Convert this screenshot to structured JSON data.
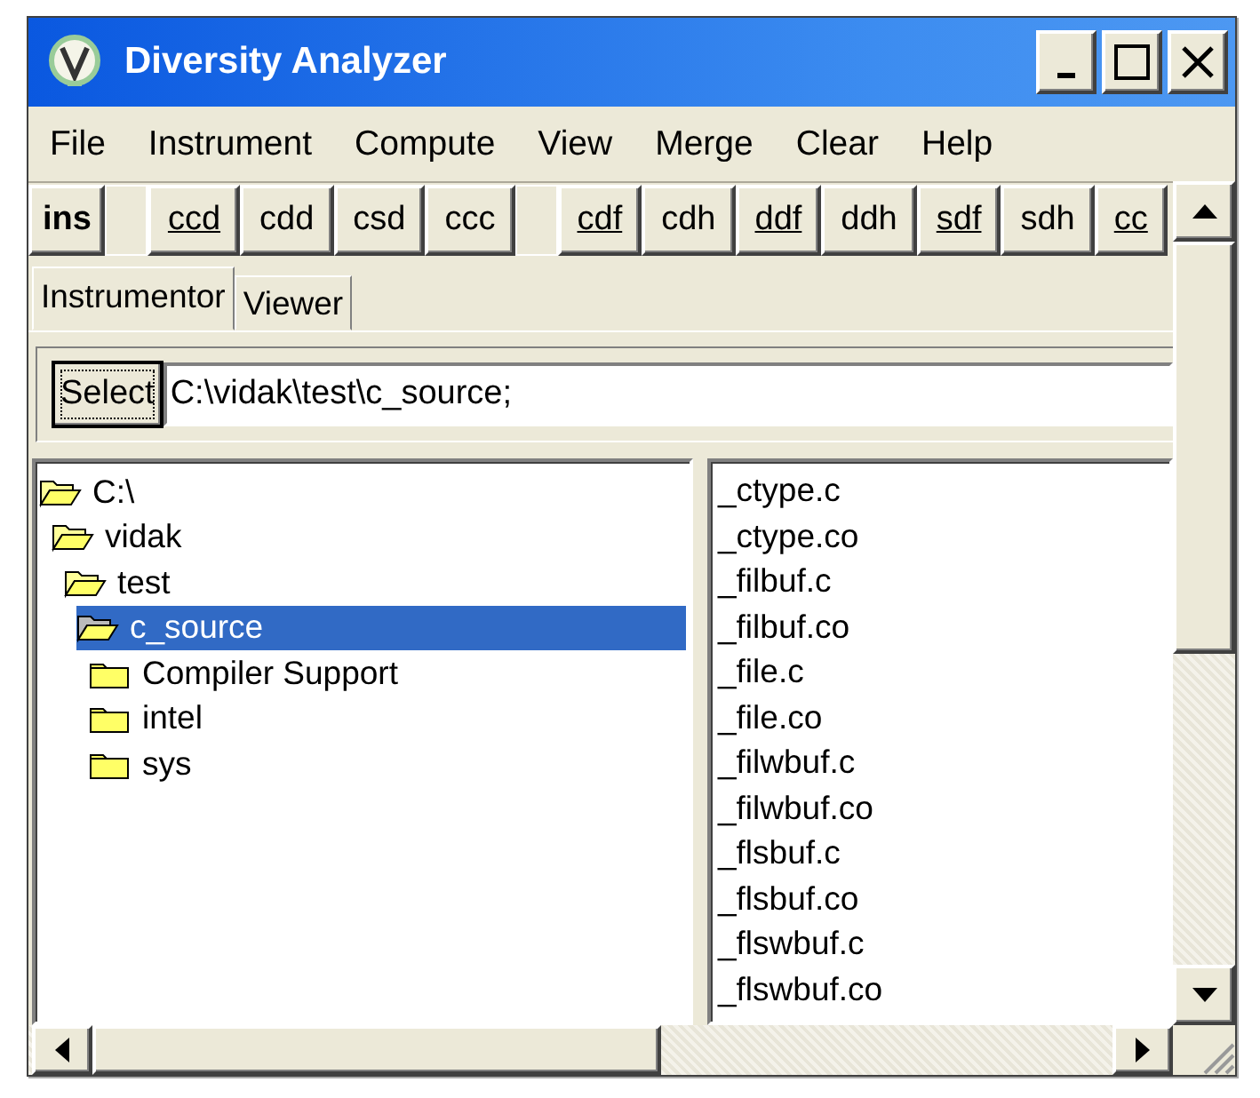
{
  "window": {
    "title": "Diversity Analyzer"
  },
  "title_buttons": [
    {
      "kind": "minimize"
    },
    {
      "kind": "maximize"
    },
    {
      "kind": "close"
    }
  ],
  "menu": [
    "File",
    "Instrument",
    "Compute",
    "View",
    "Merge",
    "Clear",
    "Help"
  ],
  "toolbar": [
    {
      "kind": "button",
      "label": "ins",
      "bold": true,
      "underlined": false
    },
    {
      "kind": "spacer"
    },
    {
      "kind": "button",
      "label": "ccd",
      "bold": false,
      "underlined": true
    },
    {
      "kind": "button",
      "label": "cdd",
      "bold": false,
      "underlined": false
    },
    {
      "kind": "button",
      "label": "csd",
      "bold": false,
      "underlined": false
    },
    {
      "kind": "button",
      "label": "ccc",
      "bold": false,
      "underlined": false
    },
    {
      "kind": "spacer"
    },
    {
      "kind": "button",
      "label": "cdf",
      "bold": false,
      "underlined": true
    },
    {
      "kind": "button",
      "label": "cdh",
      "bold": false,
      "underlined": false
    },
    {
      "kind": "button",
      "label": "ddf",
      "bold": false,
      "underlined": true
    },
    {
      "kind": "button",
      "label": "ddh",
      "bold": false,
      "underlined": false
    },
    {
      "kind": "button",
      "label": "sdf",
      "bold": false,
      "underlined": true
    },
    {
      "kind": "button",
      "label": "sdh",
      "bold": false,
      "underlined": false
    },
    {
      "kind": "button",
      "label": "cc",
      "bold": false,
      "underlined": true
    }
  ],
  "tabs": [
    {
      "label": "Instrumentor",
      "selected": true
    },
    {
      "label": "Viewer",
      "selected": false
    }
  ],
  "select_button": "Select",
  "path_field": {
    "value": "C:\\vidak\\test\\c_source;"
  },
  "tree": [
    {
      "label": "C:\\",
      "expanded": true,
      "selected": false,
      "children": [
        {
          "label": "vidak",
          "expanded": true,
          "selected": false,
          "children": [
            {
              "label": "test",
              "expanded": true,
              "selected": false,
              "children": [
                {
                  "label": "c_source",
                  "expanded": true,
                  "selected": true,
                  "children": [
                    {
                      "label": "Compiler Support",
                      "expanded": false,
                      "selected": false
                    },
                    {
                      "label": "intel",
                      "expanded": false,
                      "selected": false
                    },
                    {
                      "label": "sys",
                      "expanded": false,
                      "selected": false
                    }
                  ]
                }
              ]
            }
          ]
        }
      ]
    }
  ],
  "files": [
    "_ctype.c",
    "_ctype.co",
    "_filbuf.c",
    "_filbuf.co",
    "_file.c",
    "_file.co",
    "_filwbuf.c",
    "_filwbuf.co",
    "_flsbuf.c",
    "_flsbuf.co",
    "_flswbuf.c",
    "_flswbuf.co"
  ]
}
